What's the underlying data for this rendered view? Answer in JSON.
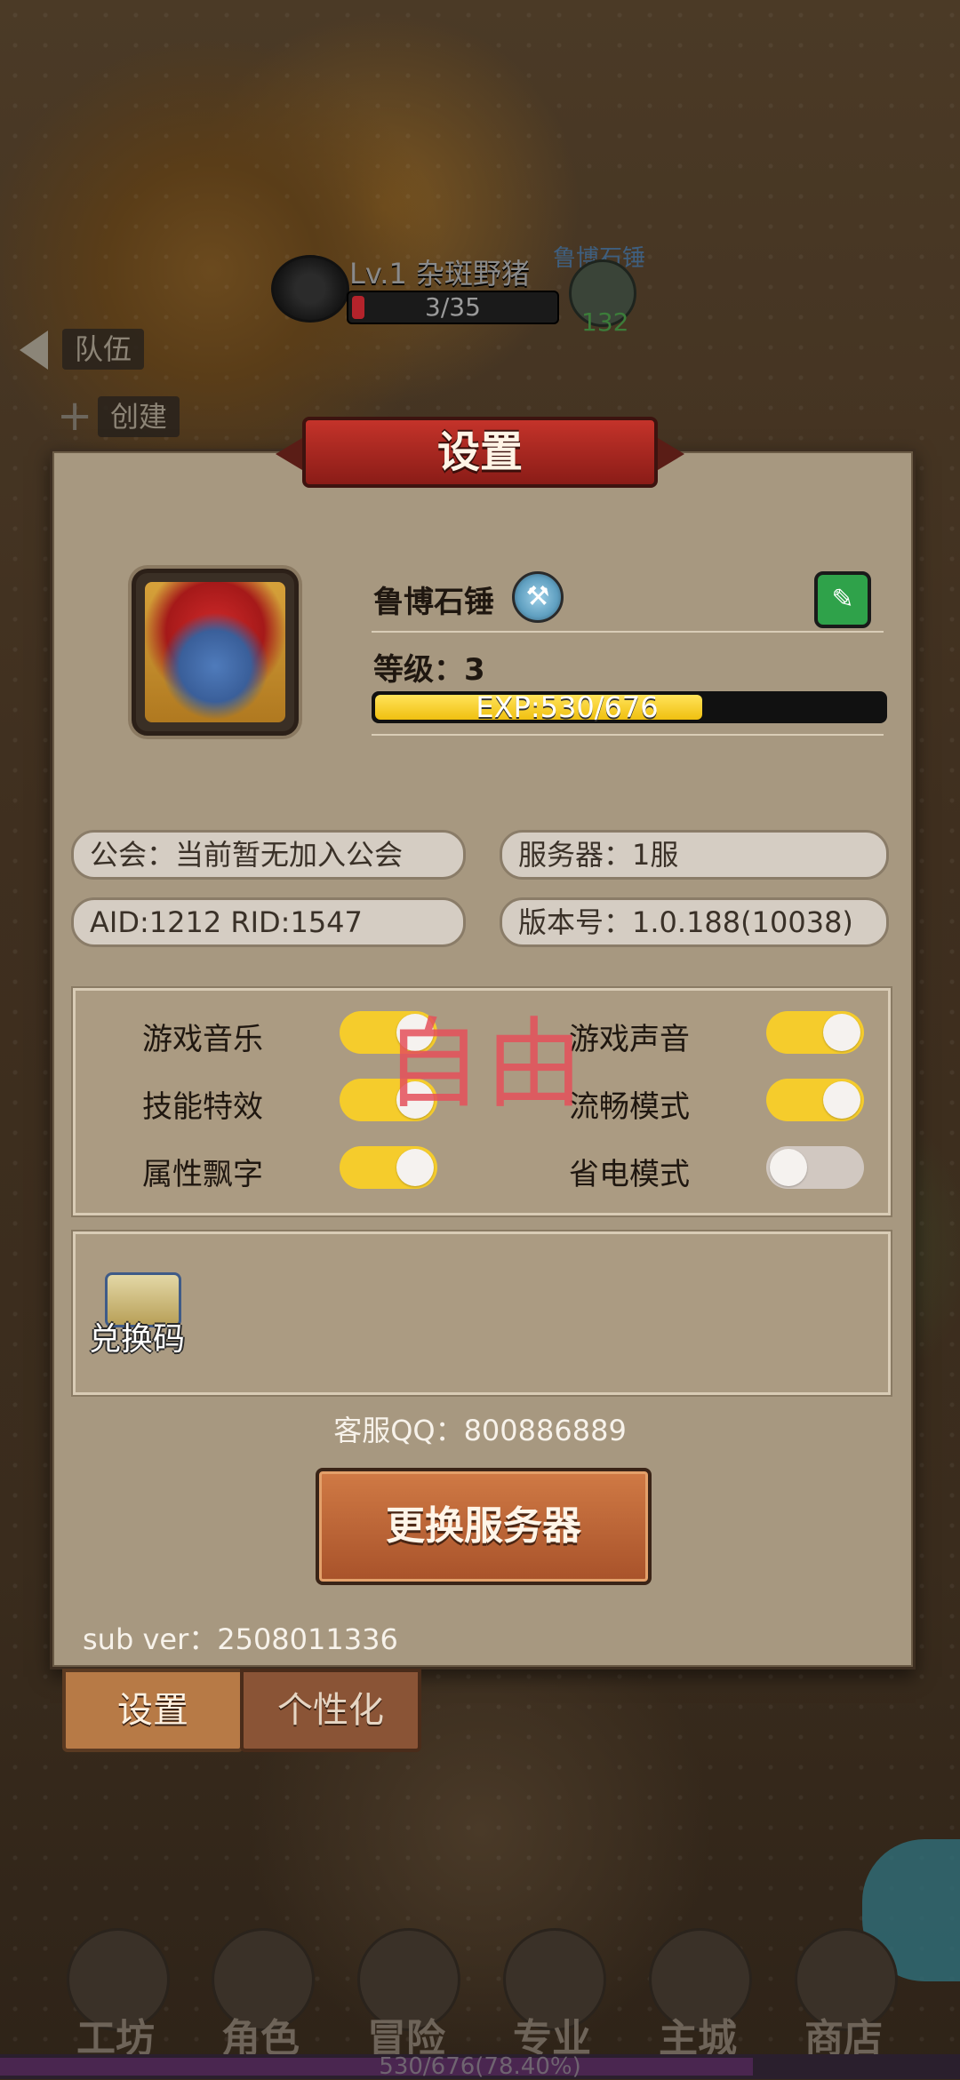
{
  "hud": {
    "enemy_name": "Lv.1 杂斑野猪",
    "enemy_hp": "3/35",
    "ally_name": "鲁博石锤",
    "ally_num": "132",
    "team_button": "队伍",
    "create_button": "创建"
  },
  "settings": {
    "title": "设置",
    "player_name": "鲁博石锤",
    "level_label": "等级：3",
    "exp_text": "EXP:530/676",
    "exp_current": 530,
    "exp_max": 676,
    "guild": "公会：当前暂无加入公会",
    "server": "服务器：1服",
    "ids": "AID:1212  RID:1547",
    "version": "版本号：1.0.188(10038)",
    "toggles": [
      {
        "label": "游戏音乐",
        "on": true
      },
      {
        "label": "游戏声音",
        "on": true
      },
      {
        "label": "技能特效",
        "on": true
      },
      {
        "label": "流畅模式",
        "on": true
      },
      {
        "label": "属性飘字",
        "on": true
      },
      {
        "label": "省电模式",
        "on": false
      }
    ],
    "watermark": "自由",
    "redeem_label": "兑换码",
    "qq": "客服QQ：800886889",
    "change_server": "更换服务器",
    "sub_ver": "sub ver：2508011336"
  },
  "tabs": {
    "settings": "设置",
    "personalize": "个性化"
  },
  "nav": [
    {
      "label": "工坊",
      "icon": "workshop-icon"
    },
    {
      "label": "角色",
      "icon": "character-icon"
    },
    {
      "label": "冒险",
      "icon": "adventure-icon"
    },
    {
      "label": "专业",
      "icon": "profession-icon"
    },
    {
      "label": "主城",
      "icon": "main-city-icon"
    },
    {
      "label": "商店",
      "icon": "shop-icon"
    }
  ],
  "bottom_exp": "530/676(78.40%)",
  "bottom_exp_fraction": 0.784
}
